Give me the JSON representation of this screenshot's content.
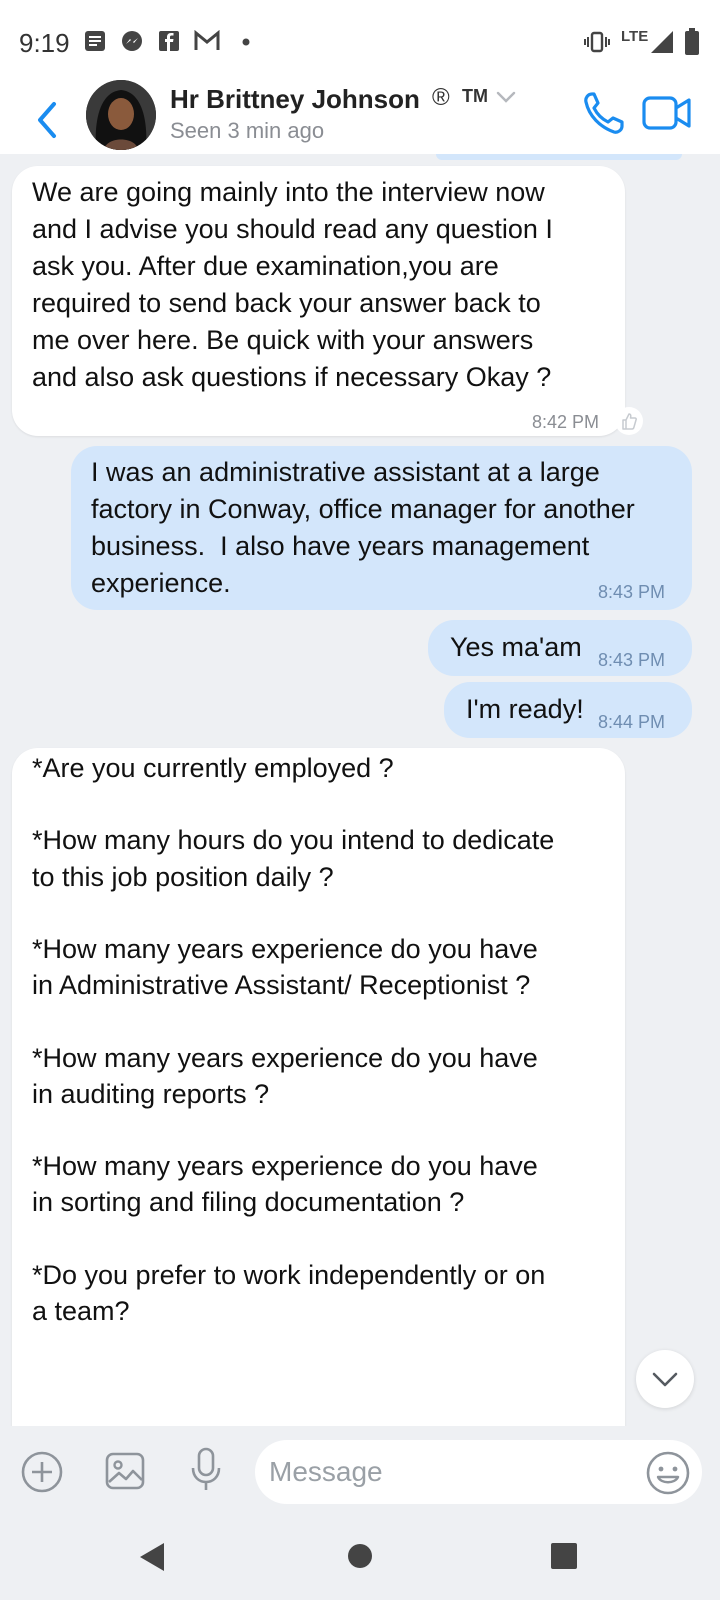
{
  "status_bar": {
    "time": "9:19",
    "network": "LTE"
  },
  "header": {
    "name": "Hr Brittney Johnson",
    "registered_mark": "®",
    "trademark": "TM",
    "status": "Seen 3 min ago"
  },
  "messages": [
    {
      "direction": "incoming",
      "text": "We are going mainly into the interview now and I advise you should read any question I ask you. After due examination,you are required to send back your answer back to me over here. Be quick with your answers and also ask questions if necessary Okay ?",
      "time": "8:42 PM"
    },
    {
      "direction": "outgoing",
      "text": "I was an administrative assistant at a large factory in Conway, office manager for another business.  I also have years management experience.",
      "time": "8:43 PM"
    },
    {
      "direction": "outgoing",
      "text": "Yes ma'am",
      "time": "8:43 PM"
    },
    {
      "direction": "outgoing",
      "text": "I'm ready!",
      "time": "8:44 PM"
    },
    {
      "direction": "incoming",
      "text": "*Are you currently employed ?\n\n*How many hours do you intend to dedicate to this job position daily ?\n\n*How many years experience do you have in Administrative Assistant/ Receptionist ?\n\n*How many years experience do you have in auditing reports ?\n\n*How many years experience do you have in sorting and filing documentation ?\n\n*Do you prefer to work independently or on a team?"
    }
  ],
  "composer": {
    "placeholder": "Message"
  },
  "colors": {
    "accent": "#1a8cf0",
    "outgoing_bubble": "#d3e6fb",
    "incoming_bubble": "#ffffff",
    "background": "#eef0f3"
  },
  "icons": {
    "back": "chevron-left-icon",
    "call": "phone-icon",
    "video": "video-camera-icon",
    "add": "plus-circle-icon",
    "gallery": "image-icon",
    "mic": "microphone-icon",
    "emoji": "smiley-icon"
  }
}
